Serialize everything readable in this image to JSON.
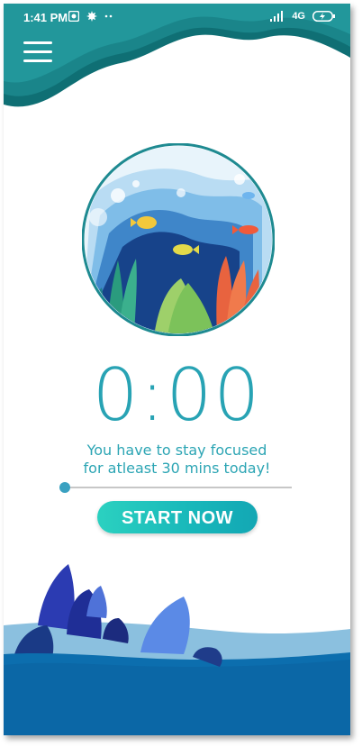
{
  "status_bar": {
    "time": "1:41 PM",
    "network": "4G",
    "left_icons": [
      "camera-icon",
      "maple-leaf-icon",
      "dots-icon"
    ],
    "right_icons": [
      "signal-icon",
      "battery-charging-icon"
    ]
  },
  "header": {
    "menu_icon": "hamburger-menu-icon",
    "accent_color": "#1f8f95"
  },
  "timer": {
    "value": "0:00",
    "color": "#28a3b4"
  },
  "message": {
    "line1": "You have to stay focused",
    "line2": "for atleast 30 mins today!"
  },
  "slider": {
    "value": 0
  },
  "start_button": {
    "label": "START NOW"
  }
}
